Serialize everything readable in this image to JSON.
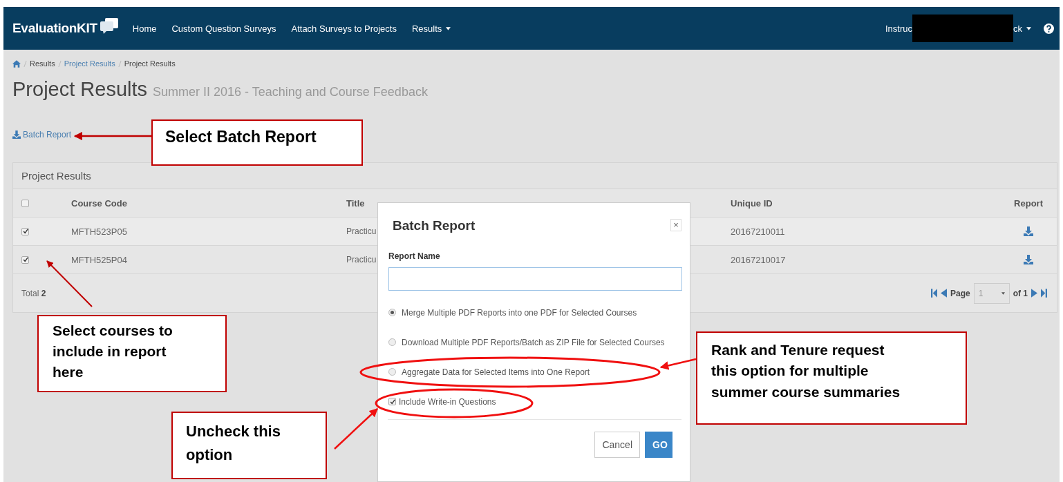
{
  "navbar": {
    "brand": "EvaluationKIT",
    "links": [
      {
        "label": "Home",
        "dropdown": false
      },
      {
        "label": "Custom Question Surveys",
        "dropdown": false
      },
      {
        "label": "Attach Surveys to Projects",
        "dropdown": false
      },
      {
        "label": "Results",
        "dropdown": true
      }
    ],
    "user": {
      "text_start": "Instruc",
      "text_end": "ck",
      "redacted": true
    }
  },
  "breadcrumb": [
    {
      "label": "Results",
      "link": false
    },
    {
      "label": "Project Results",
      "link": true
    },
    {
      "label": "Project Results",
      "link": false
    }
  ],
  "page_title": "Project Results",
  "page_subtitle": "Summer II 2016 - Teaching and Course Feedback",
  "batch_report_link": "Batch Report",
  "panel": {
    "title": "Project Results",
    "select_all_checked": false,
    "columns": [
      "Course Code",
      "Title",
      "Unique ID",
      "Report"
    ],
    "rows": [
      {
        "checked": true,
        "course_code": "MFTH523P05",
        "title": "Practicu",
        "unique_id": "20167210011"
      },
      {
        "checked": true,
        "course_code": "MFTH525P04",
        "title": "Practicu",
        "unique_id": "20167210017"
      }
    ],
    "total_label": "Total",
    "total": "2",
    "pager": {
      "label": "Page",
      "value": "1",
      "of": "of 1"
    }
  },
  "modal": {
    "title": "Batch Report",
    "close": "×",
    "field_label": "Report Name",
    "options": [
      {
        "kind": "radio",
        "label": "Merge Multiple PDF Reports into one PDF for Selected Courses",
        "selected": true
      },
      {
        "kind": "radio",
        "label": "Download Multiple PDF Reports/Batch as ZIP File for Selected Courses",
        "selected": false
      },
      {
        "kind": "radio",
        "label": "Aggregate Data for Selected Items into One Report",
        "selected": false
      },
      {
        "kind": "checkbox",
        "label": "Include Write-in Questions",
        "checked": true
      }
    ],
    "buttons": [
      {
        "kind": "default",
        "label": "Cancel"
      },
      {
        "kind": "primary",
        "label": "GO"
      }
    ]
  },
  "callouts": [
    {
      "text": "Select Batch Report"
    },
    {
      "text": "Select courses to include in report here"
    },
    {
      "text": "Rank and Tenure request this option for multiple summer course summaries"
    },
    {
      "text": "Uncheck this option"
    }
  ]
}
